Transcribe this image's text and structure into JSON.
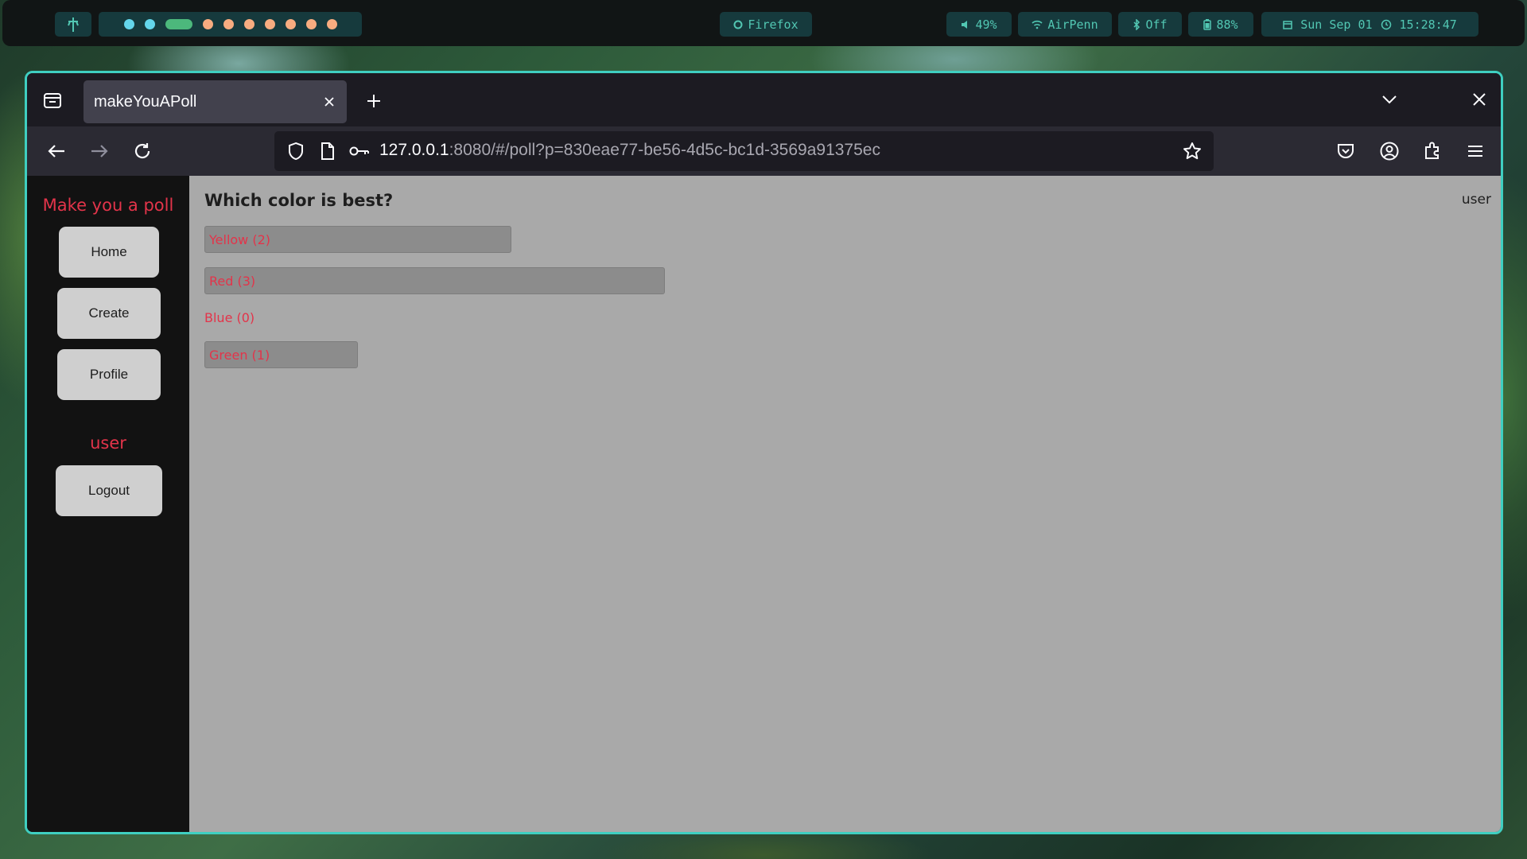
{
  "topbar": {
    "active_app": "Firefox",
    "volume": "49%",
    "wifi": "AirPenn",
    "bluetooth": "Off",
    "battery": "88%",
    "date": "Sun Sep 01",
    "time": "15:28:47"
  },
  "browser": {
    "tab_title": "makeYouAPoll",
    "url_host": "127.0.0.1",
    "url_rest": ":8080/#/poll?p=830eae77-be56-4d5c-bc1d-3569a91375ec"
  },
  "sidebar": {
    "brand": "Make you a poll",
    "home_label": "Home",
    "create_label": "Create",
    "profile_label": "Profile",
    "username": "user",
    "logout_label": "Logout"
  },
  "header": {
    "user": "user"
  },
  "poll": {
    "question": "Which color is best?",
    "options": [
      {
        "label": "Yellow (2)",
        "votes": 2
      },
      {
        "label": "Red (3)",
        "votes": 3
      },
      {
        "label": "Blue (0)",
        "votes": 0
      },
      {
        "label": "Green (1)",
        "votes": 1
      }
    ]
  },
  "colors": {
    "accent": "#e3344a",
    "window_border": "#3fcfc1",
    "bar_fill": "#8c8c8c"
  }
}
